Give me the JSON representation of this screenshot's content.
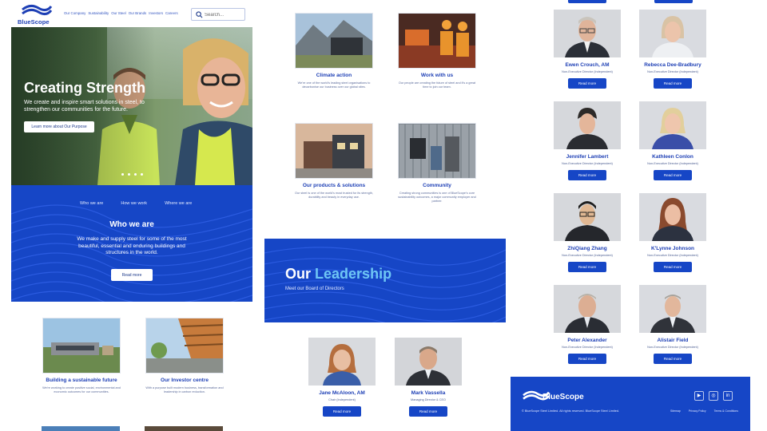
{
  "brand": {
    "name": "BlueScope",
    "primary": "#1646c6",
    "accent": "#6ec6f5"
  },
  "nav": {
    "items": [
      "Our Company",
      "Sustainability",
      "Our Steel",
      "Our Brands",
      "Investors",
      "Careers"
    ],
    "search_placeholder": "Search..."
  },
  "hero": {
    "title": "Creating Strength",
    "subtitle": "We create and inspire smart solutions in steel, to strengthen our communities for the future.",
    "cta": "Learn more about Our Purpose",
    "slide_count": 4
  },
  "who": {
    "tabs": [
      "Who we are",
      "How we work",
      "Where we are"
    ],
    "title": "Who we are",
    "text": "We make and supply steel for some of the most beautiful, essential and enduring buildings and structures in the world.",
    "cta": "Read more"
  },
  "cards_left": [
    {
      "title": "Building a sustainable future",
      "desc": "We're working to create positive social, environmental and economic outcomes for our communities."
    },
    {
      "title": "Our Investor centre",
      "desc": "With a purpose built modern business, transformation and leadership in carbon reduction."
    }
  ],
  "cards_mid": [
    {
      "title": "Climate action",
      "desc": "We're one of the world's leading steel organisations to decarbonise our business over our global sites."
    },
    {
      "title": "Work with us",
      "desc": "Our people are creating the future of steel and it's a great time to join our team."
    },
    {
      "title": "Our products & solutions",
      "desc": "Our steel is one of the world's most trusted for its strength, durability and beauty in everyday use."
    },
    {
      "title": "Community",
      "desc": "Creating strong communities is one of BlueScope's core sustainability outcomes, a major community employer and partner."
    }
  ],
  "leadership": {
    "title_main": "Our",
    "title_highlight": "Leadership",
    "subtitle": "Meet our Board of Directors"
  },
  "people_mid": [
    {
      "name": "Jane McAloon, AM",
      "role": "Chair (Independent)",
      "cta": "Read more"
    },
    {
      "name": "Mark Vassella",
      "role": "Managing Director & CEO",
      "cta": "Read more"
    }
  ],
  "people_right": [
    {
      "name": "Ewen Crouch, AM",
      "role": "Non-Executive Director (Independent)",
      "cta": "Read more"
    },
    {
      "name": "Rebecca Dee-Bradbury",
      "role": "Non-Executive Director (Independent)",
      "cta": "Read more"
    },
    {
      "name": "Jennifer Lambert",
      "role": "Non-Executive Director (Independent)",
      "cta": "Read more"
    },
    {
      "name": "Kathleen Conlon",
      "role": "Non-Executive Director (Independent)",
      "cta": "Read more"
    },
    {
      "name": "ZhiQiang Zhang",
      "role": "Non-Executive Director (Independent)",
      "cta": "Read more"
    },
    {
      "name": "K'Lynne Johnson",
      "role": "Non-Executive Director (Independent)",
      "cta": "Read more"
    },
    {
      "name": "Peter Alexander",
      "role": "Non-Executive Director (Independent)",
      "cta": "Read more"
    },
    {
      "name": "Alistair Field",
      "role": "Non-Executive Director (Independent)",
      "cta": "Read more"
    }
  ],
  "footer": {
    "logo": "BlueScope",
    "copyright": "© BlueScope Steel Limited. All rights reserved. BlueScope Steel Limited.",
    "links": [
      "Sitemap",
      "Privacy Policy",
      "Terms & Conditions"
    ],
    "social": [
      "youtube-icon",
      "instagram-icon",
      "linkedin-icon"
    ]
  }
}
